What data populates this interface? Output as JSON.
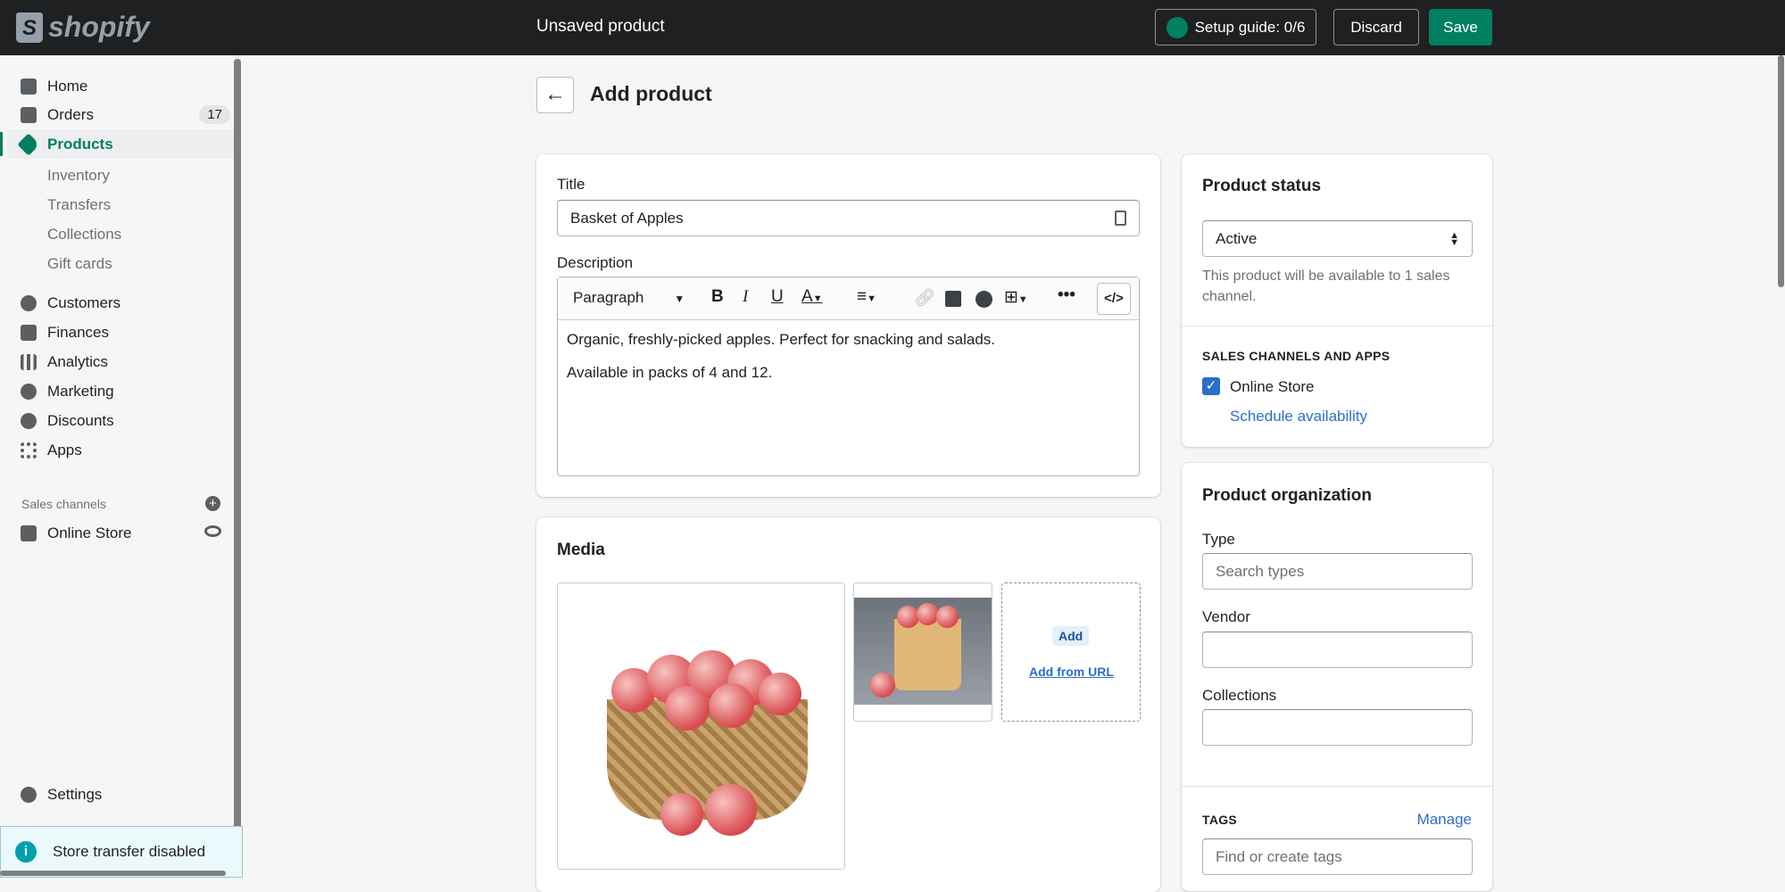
{
  "topbar": {
    "brand": "shopify",
    "title": "Unsaved product",
    "setup_guide": "Setup guide: 0/6",
    "discard": "Discard",
    "save": "Save"
  },
  "sidebar": {
    "items": [
      {
        "label": "Home"
      },
      {
        "label": "Orders",
        "badge": "17"
      },
      {
        "label": "Products"
      },
      {
        "label": "Inventory"
      },
      {
        "label": "Transfers"
      },
      {
        "label": "Collections"
      },
      {
        "label": "Gift cards"
      },
      {
        "label": "Customers"
      },
      {
        "label": "Finances"
      },
      {
        "label": "Analytics"
      },
      {
        "label": "Marketing"
      },
      {
        "label": "Discounts"
      },
      {
        "label": "Apps"
      }
    ],
    "sales_channels_label": "Sales channels",
    "online_store": "Online Store",
    "settings": "Settings",
    "store_transfer": "Store transfer disabled"
  },
  "page": {
    "title": "Add product"
  },
  "product": {
    "title_label": "Title",
    "title_value": "Basket of Apples",
    "description_label": "Description",
    "format": "Paragraph",
    "description_lines": [
      "Organic, freshly-picked apples. Perfect for snacking and salads.",
      "Available in packs of 4 and 12."
    ]
  },
  "media": {
    "title": "Media",
    "add": "Add",
    "add_from_url": "Add from URL"
  },
  "status": {
    "title": "Product status",
    "value": "Active",
    "help": "This product will be available to 1 sales channel.",
    "channels_caption": "SALES CHANNELS AND APPS",
    "online_store": "Online Store",
    "online_store_checked": true,
    "schedule": "Schedule availability"
  },
  "organization": {
    "title": "Product organization",
    "type_label": "Type",
    "type_placeholder": "Search types",
    "vendor_label": "Vendor",
    "collections_label": "Collections",
    "tags_caption": "TAGS",
    "manage": "Manage",
    "tags_placeholder": "Find or create tags"
  },
  "colors": {
    "accent": "#008060",
    "topbar": "#1f2021",
    "link": "#2c6ecb"
  }
}
